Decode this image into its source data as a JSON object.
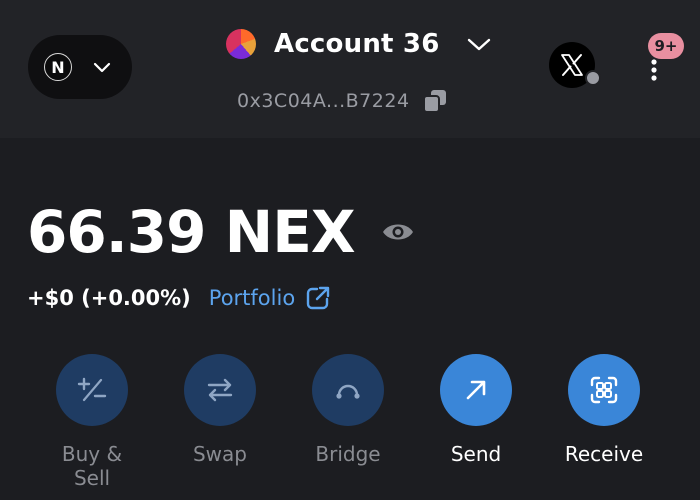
{
  "network": {
    "logo_letter": "N"
  },
  "account": {
    "name": "Account 36",
    "address": "0x3C04A...B7224"
  },
  "notifications": {
    "badge": "9+"
  },
  "balance": {
    "amount": "66.39 NEX",
    "change": "+$0 (+0.00%)",
    "portfolio_label": "Portfolio"
  },
  "actions": [
    {
      "label": "Buy & Sell",
      "icon": "plus-minus-icon",
      "enabled": false
    },
    {
      "label": "Swap",
      "icon": "swap-arrows-icon",
      "enabled": false
    },
    {
      "label": "Bridge",
      "icon": "bridge-icon",
      "enabled": false
    },
    {
      "label": "Send",
      "icon": "arrow-up-right-icon",
      "enabled": true
    },
    {
      "label": "Receive",
      "icon": "scan-icon",
      "enabled": true
    }
  ],
  "colors": {
    "background": "#1c1d21",
    "header": "#222327",
    "accent": "#3a86d8",
    "link": "#5ca4ee",
    "badge": "#e88fa0",
    "muted_text": "#9a9ca3"
  }
}
